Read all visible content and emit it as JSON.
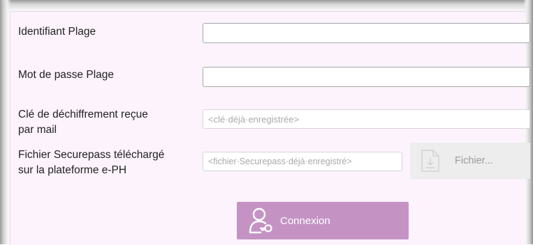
{
  "login": {
    "identifiant_label": "Identifiant Plage",
    "identifiant_value": "",
    "password_label": "Mot de passe Plage",
    "password_value": "",
    "key_label_line1": "Clé de déchiffrement reçue",
    "key_label_line2": "par mail",
    "key_placeholder": "<clé·déjà·enregistrée>",
    "file_label_line1": "Fichier Securepass téléchargé",
    "file_label_line2": "sur la plateforme e-PH",
    "file_placeholder": "<fichier·Securepass·déjà·enregistré>",
    "file_button_label": "Fichier...",
    "connect_button_label": "Connexion"
  },
  "colors": {
    "panel_background": "#fcf3fc",
    "connect_button": "#c493c4",
    "file_button": "#ededed"
  },
  "icons": {
    "file_button": "file-upload-icon",
    "connect_button": "user-key-icon"
  }
}
